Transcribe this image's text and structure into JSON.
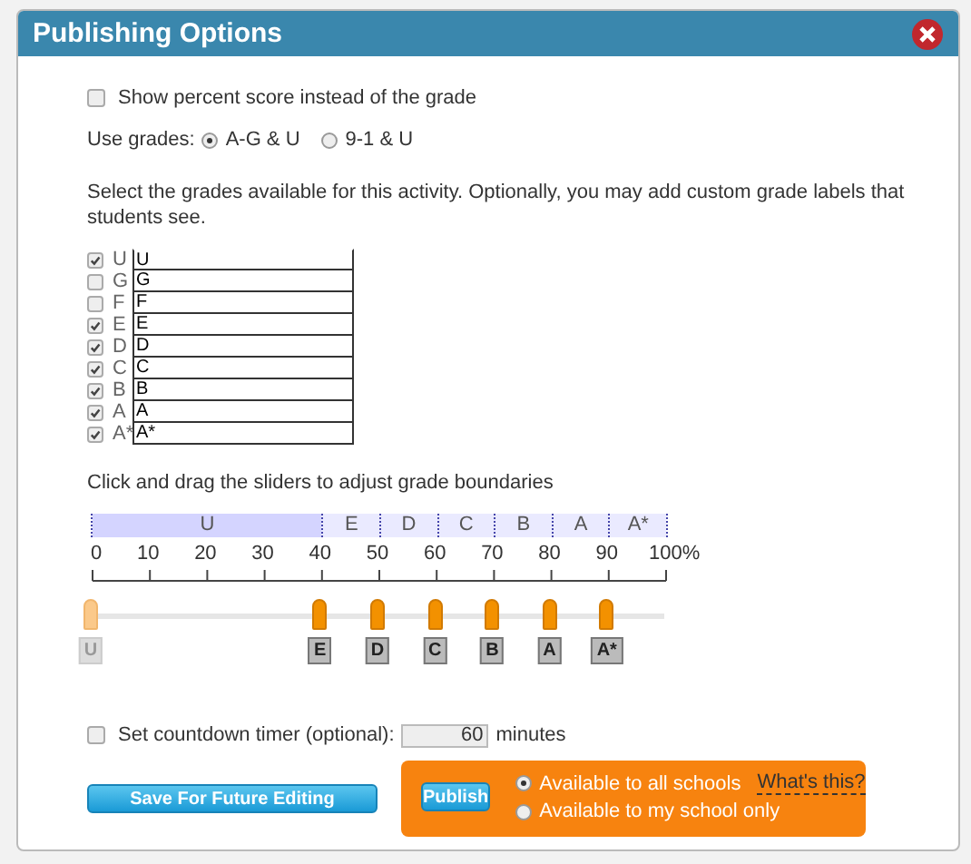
{
  "window": {
    "title": "Publishing Options"
  },
  "show_percent": {
    "label": "Show percent score instead of the grade",
    "checked": false
  },
  "use_grades": {
    "label": "Use grades:",
    "options": [
      {
        "label": "A-G & U",
        "selected": true
      },
      {
        "label": "9-1 & U",
        "selected": false
      }
    ]
  },
  "grades_intro": "Select the grades available for this activity. Optionally, you may add custom grade labels that students see.",
  "grades": [
    {
      "grade": "U",
      "checked": true,
      "value": "U"
    },
    {
      "grade": "G",
      "checked": false,
      "value": "G"
    },
    {
      "grade": "F",
      "checked": false,
      "value": "F"
    },
    {
      "grade": "E",
      "checked": true,
      "value": "E"
    },
    {
      "grade": "D",
      "checked": true,
      "value": "D"
    },
    {
      "grade": "C",
      "checked": true,
      "value": "C"
    },
    {
      "grade": "B",
      "checked": true,
      "value": "B"
    },
    {
      "grade": "A",
      "checked": true,
      "value": "A"
    },
    {
      "grade": "A*",
      "checked": true,
      "value": "A*"
    }
  ],
  "sliders_intro": "Click and drag the sliders to adjust grade boundaries",
  "bands": [
    "U",
    "E",
    "D",
    "C",
    "B",
    "A",
    "A*"
  ],
  "scale_ticks": [
    "0",
    "10",
    "20",
    "30",
    "40",
    "50",
    "60",
    "70",
    "80",
    "90",
    "100%"
  ],
  "boundaries": [
    {
      "label": "U",
      "level": 0,
      "disabled": true
    },
    {
      "label": "E",
      "level": 0.4,
      "disabled": false
    },
    {
      "label": "D",
      "level": 0.5,
      "disabled": false
    },
    {
      "label": "C",
      "level": 0.6,
      "disabled": false
    },
    {
      "label": "B",
      "level": 0.7,
      "disabled": false
    },
    {
      "label": "A",
      "level": 0.8,
      "disabled": false
    },
    {
      "label": "A*",
      "level": 0.9,
      "disabled": false
    }
  ],
  "timer": {
    "label": "Set countdown timer (optional):",
    "checked": false,
    "value": "60",
    "unit": "minutes"
  },
  "save_button": "Save For Future Editing",
  "publish_button": "Publish",
  "availability": [
    {
      "label": "Available to all schools",
      "selected": true
    },
    {
      "label": "Available to my school only",
      "selected": false
    }
  ],
  "whats_this": "What's this?"
}
